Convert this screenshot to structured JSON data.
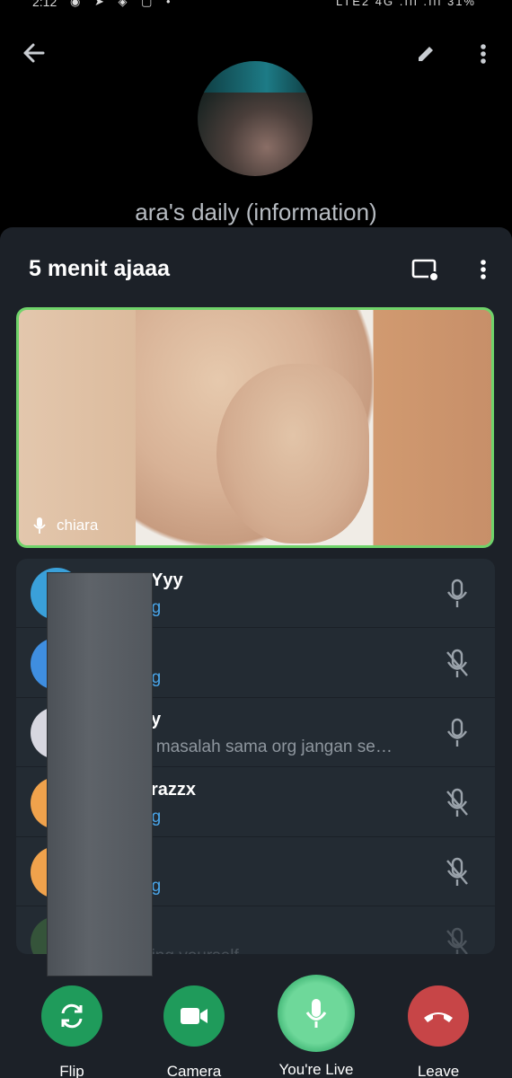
{
  "status_bar": {
    "time": "2:12",
    "left_icons": "◉ ➤ ◈ ▢ •",
    "network": "LTE2 4G .ıll .ıll",
    "battery": "31%"
  },
  "channel": {
    "title": "ara's daily (information)"
  },
  "call": {
    "title": "5 menit ajaaa",
    "video": {
      "speaker_name": "chiara",
      "border_color": "#6fd36a"
    },
    "participants": [
      {
        "name": "Yyy",
        "status": "ng",
        "status_style": "accent",
        "mic": "mic-icon",
        "avatar_color": "#3aa0d9"
      },
      {
        "name": "",
        "status": "ng",
        "status_style": "accent",
        "mic": "mic-off-icon",
        "avatar_color": "#3f8ee0"
      },
      {
        "name": "y",
        "status": "a masalah sama org jangan se…",
        "status_style": "gray",
        "mic": "mic-icon",
        "avatar_color": "#d7d7e0"
      },
      {
        "name": "razzx",
        "status": "ng",
        "status_style": "accent",
        "mic": "mic-off-icon",
        "avatar_color": "#f0a24c"
      },
      {
        "name": "",
        "status": "ng",
        "status_style": "accent",
        "mic": "mic-off-icon",
        "avatar_color": "#f0a24c"
      },
      {
        "name": "",
        "status": "eing yourself",
        "status_style": "gray",
        "mic": "mic-off-icon",
        "avatar_color": "#5aa048"
      }
    ]
  },
  "controls": {
    "flip": {
      "label": "Flip",
      "color": "#1f9b5b"
    },
    "camera": {
      "label": "Camera",
      "color": "#1f9b5b"
    },
    "live": {
      "label": "You're Live",
      "color": "#6ed89a"
    },
    "leave": {
      "label": "Leave",
      "color": "#c74547"
    }
  }
}
